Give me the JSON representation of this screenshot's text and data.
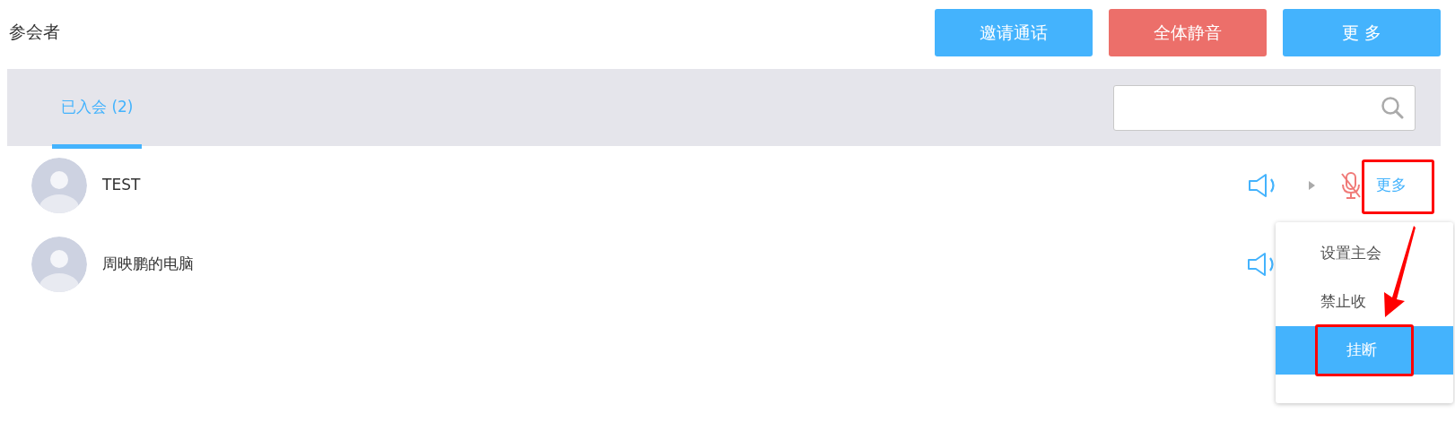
{
  "title": "参会者",
  "header_buttons": [
    {
      "label": "邀请通话",
      "kind": "primary"
    },
    {
      "label": "全体静音",
      "kind": "danger"
    },
    {
      "label": "更 多",
      "kind": "primary"
    }
  ],
  "tabs": [
    {
      "label": "已入会 (2)",
      "selected": true
    }
  ],
  "participants": [
    {
      "name": "TEST",
      "mic_muted": true,
      "more_label": "更多"
    },
    {
      "name": "周映鹏的电脑"
    }
  ],
  "menu": {
    "items": [
      {
        "label": "设置主会",
        "selected": false
      },
      {
        "label": "禁止收",
        "selected": false
      },
      {
        "label": "挂断",
        "selected": true
      }
    ]
  }
}
